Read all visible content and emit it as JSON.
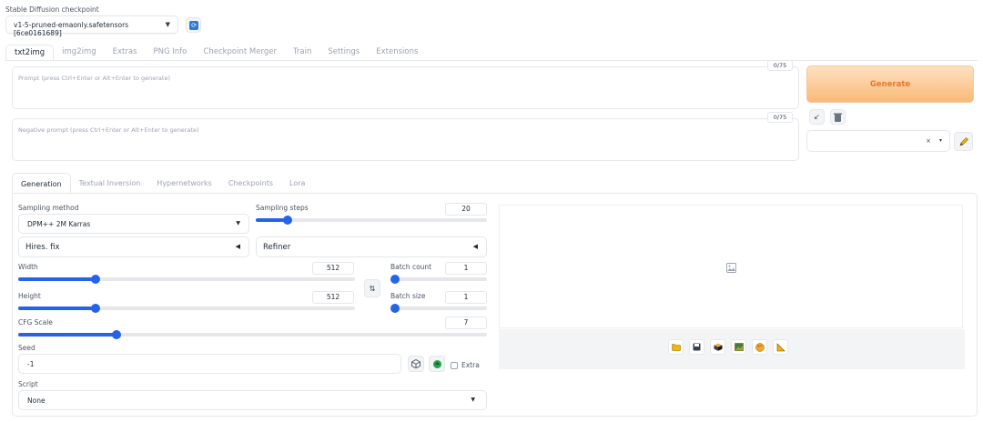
{
  "checkpoint": {
    "label": "Stable Diffusion checkpoint",
    "value": "v1-5-pruned-emaonly.safetensors [6ce0161689]"
  },
  "main_tabs": [
    {
      "label": "txt2img",
      "active": true
    },
    {
      "label": "img2img"
    },
    {
      "label": "Extras"
    },
    {
      "label": "PNG Info"
    },
    {
      "label": "Checkpoint Merger"
    },
    {
      "label": "Train"
    },
    {
      "label": "Settings"
    },
    {
      "label": "Extensions"
    }
  ],
  "prompt": {
    "placeholder": "Prompt (press Ctrl+Enter or Alt+Enter to generate)",
    "counter": "0/75"
  },
  "negative_prompt": {
    "placeholder": "Negative prompt (press Ctrl+Enter or Alt+Enter to generate)",
    "counter": "0/75"
  },
  "generate_label": "Generate",
  "style_select": {
    "clear": "×",
    "caret": "▾"
  },
  "sub_tabs": [
    {
      "label": "Generation",
      "active": true
    },
    {
      "label": "Textual Inversion"
    },
    {
      "label": "Hypernetworks"
    },
    {
      "label": "Checkpoints"
    },
    {
      "label": "Lora"
    }
  ],
  "sampling_method": {
    "label": "Sampling method",
    "value": "DPM++ 2M Karras"
  },
  "sampling_steps": {
    "label": "Sampling steps",
    "value": "20",
    "fraction": 0.137
  },
  "hires_fix": {
    "label": "Hires. fix"
  },
  "refiner": {
    "label": "Refiner"
  },
  "width": {
    "label": "Width",
    "value": "512",
    "fraction": 0.23
  },
  "height": {
    "label": "Height",
    "value": "512",
    "fraction": 0.23
  },
  "batch_count": {
    "label": "Batch count",
    "value": "1",
    "fraction": 0.0
  },
  "batch_size": {
    "label": "Batch size",
    "value": "1",
    "fraction": 0.0
  },
  "cfg_scale": {
    "label": "CFG Scale",
    "value": "7",
    "fraction": 0.21
  },
  "seed": {
    "label": "Seed",
    "value": "-1",
    "extra_label": "Extra"
  },
  "script": {
    "label": "Script",
    "value": "None"
  },
  "icons": {
    "refresh": "refresh-icon",
    "swap": "⇅",
    "paste": "↙",
    "trash": "trash-icon",
    "pencil": "pencil-icon",
    "dice": "dice-icon",
    "recycle": "recycle-icon",
    "image_placeholder": "image-icon",
    "toolbar": [
      "folder-icon",
      "save-icon",
      "zip-icon",
      "send-to-img2img-icon",
      "send-to-inpaint-icon",
      "send-to-extras-icon"
    ]
  },
  "colors": {
    "accent": "#2563eb",
    "generate_text": "#e8772e",
    "generate_bg": "#f9b977"
  }
}
